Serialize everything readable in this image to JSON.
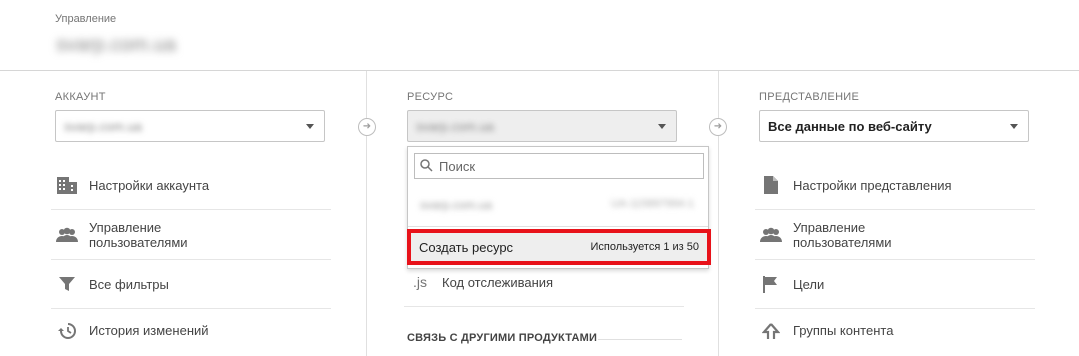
{
  "header": {
    "label": "Управление",
    "site": "svarp.com.ua"
  },
  "account": {
    "title": "АККАУНТ",
    "selected": "svarp.com.ua",
    "items": [
      {
        "label": "Настройки аккаунта",
        "icon": "building-icon"
      },
      {
        "label": "Управление\nпользователями",
        "icon": "users-icon"
      },
      {
        "label": "Все фильтры",
        "icon": "filter-icon"
      },
      {
        "label": "История изменений",
        "icon": "history-icon"
      }
    ]
  },
  "resource": {
    "title": "РЕСУРС",
    "selected": "svarp.com.ua",
    "search_placeholder": "Поиск",
    "option_name": "svarp.com.ua",
    "option_id": "UA-115897994-1",
    "create_label": "Создать ресурс",
    "usage": "Используется 1 из 50",
    "tracking_label": "Код отслеживания",
    "tracking_icon_text": ".js",
    "links_title": "СВЯЗЬ С ДРУГИМИ ПРОДУКТАМИ"
  },
  "view": {
    "title": "ПРЕДСТАВЛЕНИЕ",
    "selected": "Все данные по веб-сайту",
    "items": [
      {
        "label": "Настройки представления",
        "icon": "document-icon"
      },
      {
        "label": "Управление\nпользователями",
        "icon": "users-icon"
      },
      {
        "label": "Цели",
        "icon": "flag-icon"
      },
      {
        "label": "Группы контента",
        "icon": "content-group-icon"
      }
    ]
  },
  "colors": {
    "highlight": "#e8121a",
    "icon": "#757575"
  }
}
